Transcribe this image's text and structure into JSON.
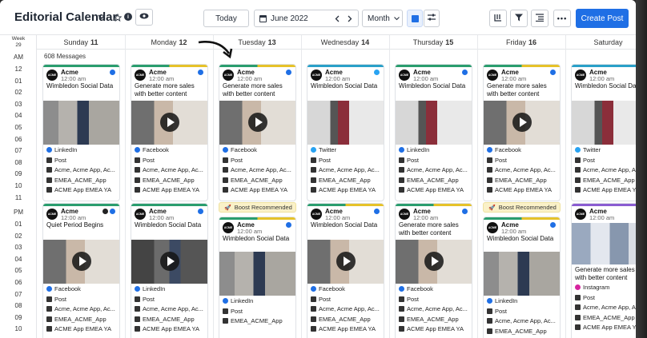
{
  "header": {
    "title": "Editorial Calendar",
    "chevron_icon": "chevron-down-icon",
    "star_icon": "star-icon",
    "info_icon": "info-icon",
    "eye_icon": "eye-icon",
    "today_label": "Today",
    "date_label": "June 2022",
    "view_label": "Month",
    "create_label": "Create Post",
    "accent": "#1f6fe5"
  },
  "gutter": {
    "week_label": "Week",
    "week_num": "29",
    "am": "AM",
    "pm": "PM",
    "am_hours": [
      "12",
      "01",
      "02",
      "03",
      "04",
      "05",
      "06",
      "07",
      "08",
      "09",
      "10",
      "11"
    ],
    "pm_hours": [
      "01",
      "02",
      "03",
      "04",
      "05",
      "06",
      "07",
      "08",
      "09",
      "10"
    ]
  },
  "days": [
    {
      "name": "Sunday",
      "num": "11"
    },
    {
      "name": "Monday",
      "num": "12"
    },
    {
      "name": "Tuesday",
      "num": "13"
    },
    {
      "name": "Wednesday",
      "num": "14"
    },
    {
      "name": "Thursday",
      "num": "15"
    },
    {
      "name": "Friday",
      "num": "16"
    },
    {
      "name": "Saturday",
      "num": ""
    }
  ],
  "message_count": "608 Messages",
  "boost_label": "Boost Recommended",
  "cards": {
    "c1": {
      "acct": "Acme",
      "time": "12:00 am",
      "text": "Wimbledon Social Data",
      "network": "LinkedIn",
      "type": "Post",
      "accounts": "Acme, Acme App, Ac...",
      "tag1": "EMEA_ACME_App",
      "tag2": "ACME App EMEA YA"
    },
    "c2": {
      "acct": "Acme",
      "time": "12:00 am",
      "text": "Generate more sales with better content",
      "network": "Facebook",
      "type": "Post",
      "accounts": "Acme, Acme App, Ac...",
      "tag1": "EMEA_ACME_App",
      "tag2": "ACME App EMEA YA"
    },
    "c3": {
      "acct": "Acme",
      "time": "12:00 am",
      "text": "Generate more sales with better content",
      "network": "Facebook",
      "type": "Post",
      "accounts": "Acme, Acme App, Ac...",
      "tag1": "EMEA_ACME_App",
      "tag2": "ACME App EMEA YA"
    },
    "c4": {
      "acct": "Acme",
      "time": "12:00 am",
      "text": "Wimbledon Social Data",
      "network": "Twitter",
      "type": "Post",
      "accounts": "Acme, Acme App, Ac...",
      "tag1": "EMEA_ACME_App",
      "tag2": "ACME App EMEA YA"
    },
    "c5": {
      "acct": "Acme",
      "time": "12:00 am",
      "text": "Wimbledon Social Data",
      "network": "LinkedIn",
      "type": "Post",
      "accounts": "Acme, Acme App, Ac...",
      "tag1": "EMEA_ACME_App",
      "tag2": "ACME App EMEA YA"
    },
    "c6": {
      "acct": "Acme",
      "time": "12:00 am",
      "text": "Generate more sales with better content",
      "network": "Facebook",
      "type": "Post",
      "accounts": "Acme, Acme App, Ac...",
      "tag1": "EMEA_ACME_App",
      "tag2": "ACME App EMEA YA"
    },
    "c7": {
      "acct": "Acme",
      "time": "12:00 am",
      "text": "Wimbledon Social Data",
      "network": "Twitter",
      "type": "Post",
      "accounts": "Acme, Acme App, Ac...",
      "tag1": "EMEA_ACME_App",
      "tag2": "ACME App EMEA YA"
    },
    "d1": {
      "acct": "Acme",
      "time": "12:00 am",
      "text": "Quiet Period Begins",
      "network": "Facebook",
      "type": "Post",
      "accounts": "Acme, Acme App, Ac...",
      "tag1": "EMEA_ACME_App",
      "tag2": "ACME App EMEA YA"
    },
    "d2": {
      "acct": "Acme",
      "time": "12:00 am",
      "text": "Wimbledon Social Data",
      "network": "LinkedIn",
      "type": "Post",
      "accounts": "Acme, Acme App, Ac...",
      "tag1": "EMEA_ACME_App",
      "tag2": "ACME App EMEA YA"
    },
    "d3": {
      "acct": "Acme",
      "time": "12:00 am",
      "text": "Wimbledon Social Data",
      "network": "LinkedIn",
      "type": "Post",
      "tag1": "EMEA_ACME_App"
    },
    "d4": {
      "acct": "Acme",
      "time": "12:00 am",
      "text": "Wimbledon Social Data",
      "network": "Facebook",
      "type": "Post",
      "accounts": "Acme, Acme App, Ac...",
      "tag1": "EMEA_ACME_App",
      "tag2": "ACME App EMEA YA"
    },
    "d5": {
      "acct": "Acme",
      "time": "12:00 am",
      "text": "Generate more sales with better content",
      "network": "Facebook",
      "type": "Post",
      "accounts": "Acme, Acme App, Ac...",
      "tag1": "EMEA_ACME_App",
      "tag2": "ACME App EMEA YA"
    },
    "d6": {
      "acct": "Acme",
      "time": "12:00 am",
      "text": "Wimbledon Social Data",
      "network": "LinkedIn",
      "type": "Post",
      "accounts": "Acme, Acme App, Ac...",
      "tag1": "EMEA_ACME_App"
    },
    "d7": {
      "acct": "Acme",
      "time": "12:00 am",
      "text": "Generate more sales with better content",
      "network": "Instagram",
      "type": "Post",
      "accounts": "Acme, Acme App, Ac...",
      "tag1": "EMEA_ACME_App",
      "tag2": "ACME App EMEA YA"
    }
  }
}
